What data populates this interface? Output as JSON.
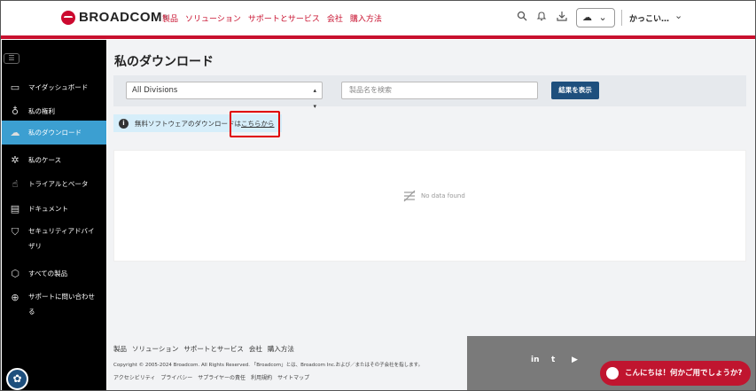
{
  "header": {
    "brand": "BROADCOM",
    "brand_mark": "®",
    "nav": [
      "製品",
      "ソリューション",
      "サポートとサービス",
      "会社",
      "購入方法"
    ],
    "icons": [
      "search-icon",
      "bell-icon",
      "download-icon",
      "cloud-icon",
      "chevron-down-icon"
    ],
    "user_name": "かっこい…",
    "accent": "#c8102e"
  },
  "sidebar": {
    "items": [
      {
        "label": "マイダッシュボード",
        "icon": "dashboard-icon"
      },
      {
        "label": "私の権利",
        "icon": "award-icon"
      },
      {
        "label": "私のダウンロード",
        "icon": "cloud-download-icon",
        "active": true
      },
      {
        "label": "私のケース",
        "icon": "bug-icon"
      },
      {
        "label": "トライアルとベータ",
        "icon": "hand-icon"
      },
      {
        "label": "ドキュメント",
        "icon": "document-icon"
      },
      {
        "label": "セキュリティアドバイザリ",
        "icon": "shield-icon"
      },
      {
        "label": "すべての製品",
        "icon": "cube-icon"
      },
      {
        "label": "サポートに問い合わせる",
        "icon": "lifebuoy-icon"
      }
    ],
    "active_color": "#3c9fd1"
  },
  "main": {
    "title": "私のダウンロード",
    "division_select": "All Divisions",
    "search_placeholder": "製品名を検索",
    "show_results": "結果を表示",
    "info_text": "無料ソフトウェアのダウンロードは",
    "info_link": "こちらから",
    "no_data": "No data found"
  },
  "footer": {
    "links": [
      "製品",
      "ソリューション",
      "サポートとサービス",
      "会社",
      "購入方法"
    ],
    "copyright": "Copyright © 2005-2024 Broadcom. All Rights Reserved. 「Broadcom」とは、Broadcom Inc.および／またはその子会社を指します。",
    "links2": [
      "アクセシビリティ",
      "プライバシー",
      "サプライヤーの責任",
      "利用規約",
      "サイトマップ"
    ],
    "social": [
      "in",
      "t",
      "▶"
    ],
    "chat_label": "こんにちは！何かご用でしょうか?"
  }
}
